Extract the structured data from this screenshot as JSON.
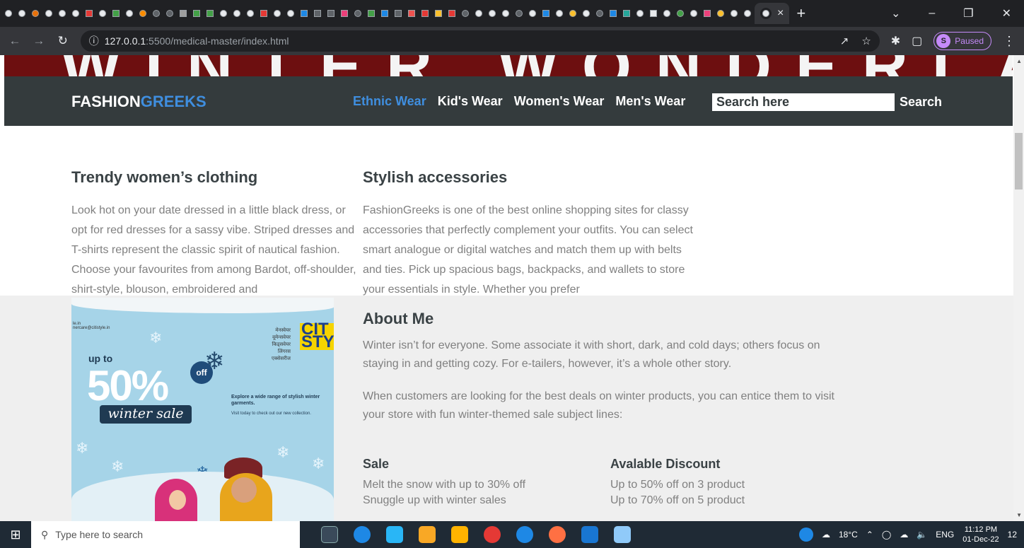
{
  "browser": {
    "tab_close": "×",
    "new_tab": "+",
    "url_host": "127.0.0.1",
    "url_path": ":5500/medical-master/index.html",
    "profile_initial": "S",
    "profile_status": "Paused"
  },
  "site": {
    "hero_text": "WINTER WONDERLAND OF",
    "logo_part1": "FASHION",
    "logo_part2": "GREEKS",
    "nav": [
      "Ethnic Wear",
      "Kid's Wear",
      "Women's Wear",
      "Men's Wear"
    ],
    "search_value": "Search here",
    "search_button": "Search"
  },
  "content": {
    "left_title": "Trendy women’s clothing",
    "left_text": "Look hot on your date dressed in a little black dress, or opt for red dresses for a sassy vibe. Striped dresses and T-shirts represent the classic spirit of nautical fashion. Choose your favourites from among Bardot, off-shoulder, shirt-style, blouson, embroidered and",
    "right_title": "Stylish accessories",
    "right_text": "FashionGreeks is one of the best online shopping sites for classy accessories that perfectly complement your outfits. You can select smart analogue or digital watches and match them up with belts and ties. Pick up spacious bags, backpacks, and wallets to store your essentials in style. Whether you prefer",
    "about_title": "About Me",
    "about_p1": "Winter isn’t for everyone. Some associate it with short, dark, and cold days; others focus on staying in and getting cozy. For e-tailers, however, it’s a whole other story.",
    "about_p2": "When customers are looking for the best deals on winter products, you can entice them to visit your store with fun winter-themed sale subject lines:",
    "sale_title": "Sale",
    "sale_lines": [
      "Melt the snow with up to 30% off",
      "Snuggle up with winter sales"
    ],
    "discount_title": "Avalable Discount",
    "discount_lines": [
      "Up to 50% off on 3 product",
      "Up to 70% off on 5 product"
    ]
  },
  "poster": {
    "url_line1": "le.in",
    "url_line2": "nercare@citistyle.in",
    "hindi_lines": [
      "मेनस्वेयर",
      "वूमेन्सवेयर",
      "किड्सवेयर",
      "लिंगरस",
      "एक्सेसरीज"
    ],
    "brand": "CIT STY",
    "upto": "up to",
    "percent": "50%",
    "off": "off",
    "winter_sale": "winter sale",
    "explore": "Explore a wide range of stylish winter garments.",
    "visit": "Visit today to check out our new collection."
  },
  "taskbar": {
    "search_placeholder": "Type here to search",
    "temperature": "18°C",
    "language": "ENG",
    "time": "11:12 PM",
    "date": "01-Dec-22",
    "notifications": "12"
  }
}
